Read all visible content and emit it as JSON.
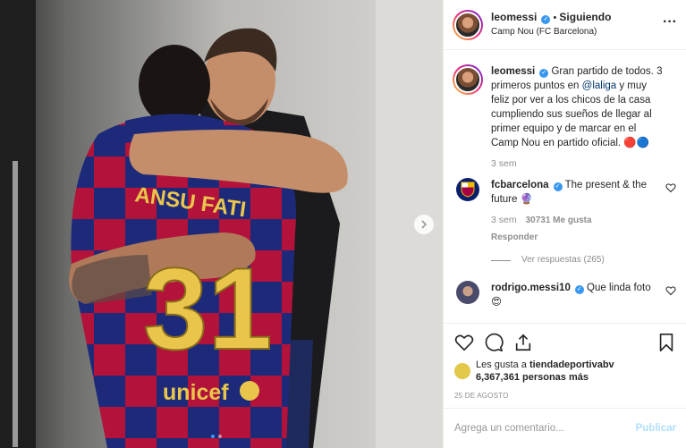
{
  "post": {
    "username": "leomessi",
    "follow_status": "Siguiendo",
    "separator": "•",
    "location": "Camp Nou (FC Barcelona)",
    "more_icon": "more-horizontal-icon",
    "jersey_name": "ANSU FATI",
    "jersey_number": "31",
    "sponsor": "unicef"
  },
  "caption": {
    "username": "leomessi",
    "text_before": "Gran partido de todos. 3 primeros puntos en ",
    "mention": "@laliga",
    "text_after": " y muy feliz por ver a los chicos de la casa cumpliendo sus sueños de llegar al primer equipo y de marcar en el Camp Nou en partido oficial. 🔴🔵",
    "time": "3 sem"
  },
  "comments": [
    {
      "username": "fcbarcelona",
      "text": "The present & the future 🔮",
      "time": "3 sem",
      "likes": "30731 Me gusta",
      "reply": "Responder",
      "view_replies": "Ver respuestas (265)"
    },
    {
      "username": "rodrigo.messi10",
      "text": "Que linda foto",
      "emoji": "😍"
    }
  ],
  "likes": {
    "prefix": "Les gusta a ",
    "user": "tiendadeportivabv",
    "count": "6,367,361 personas más"
  },
  "date": "25 DE AGOSTO",
  "add_comment": {
    "placeholder": "Agrega un comentario...",
    "publish": "Publicar"
  },
  "colors": {
    "accent": "#3897f0",
    "mention": "#003569",
    "muted": "#8e8e8e",
    "publish_disabled": "#b2dffc"
  }
}
